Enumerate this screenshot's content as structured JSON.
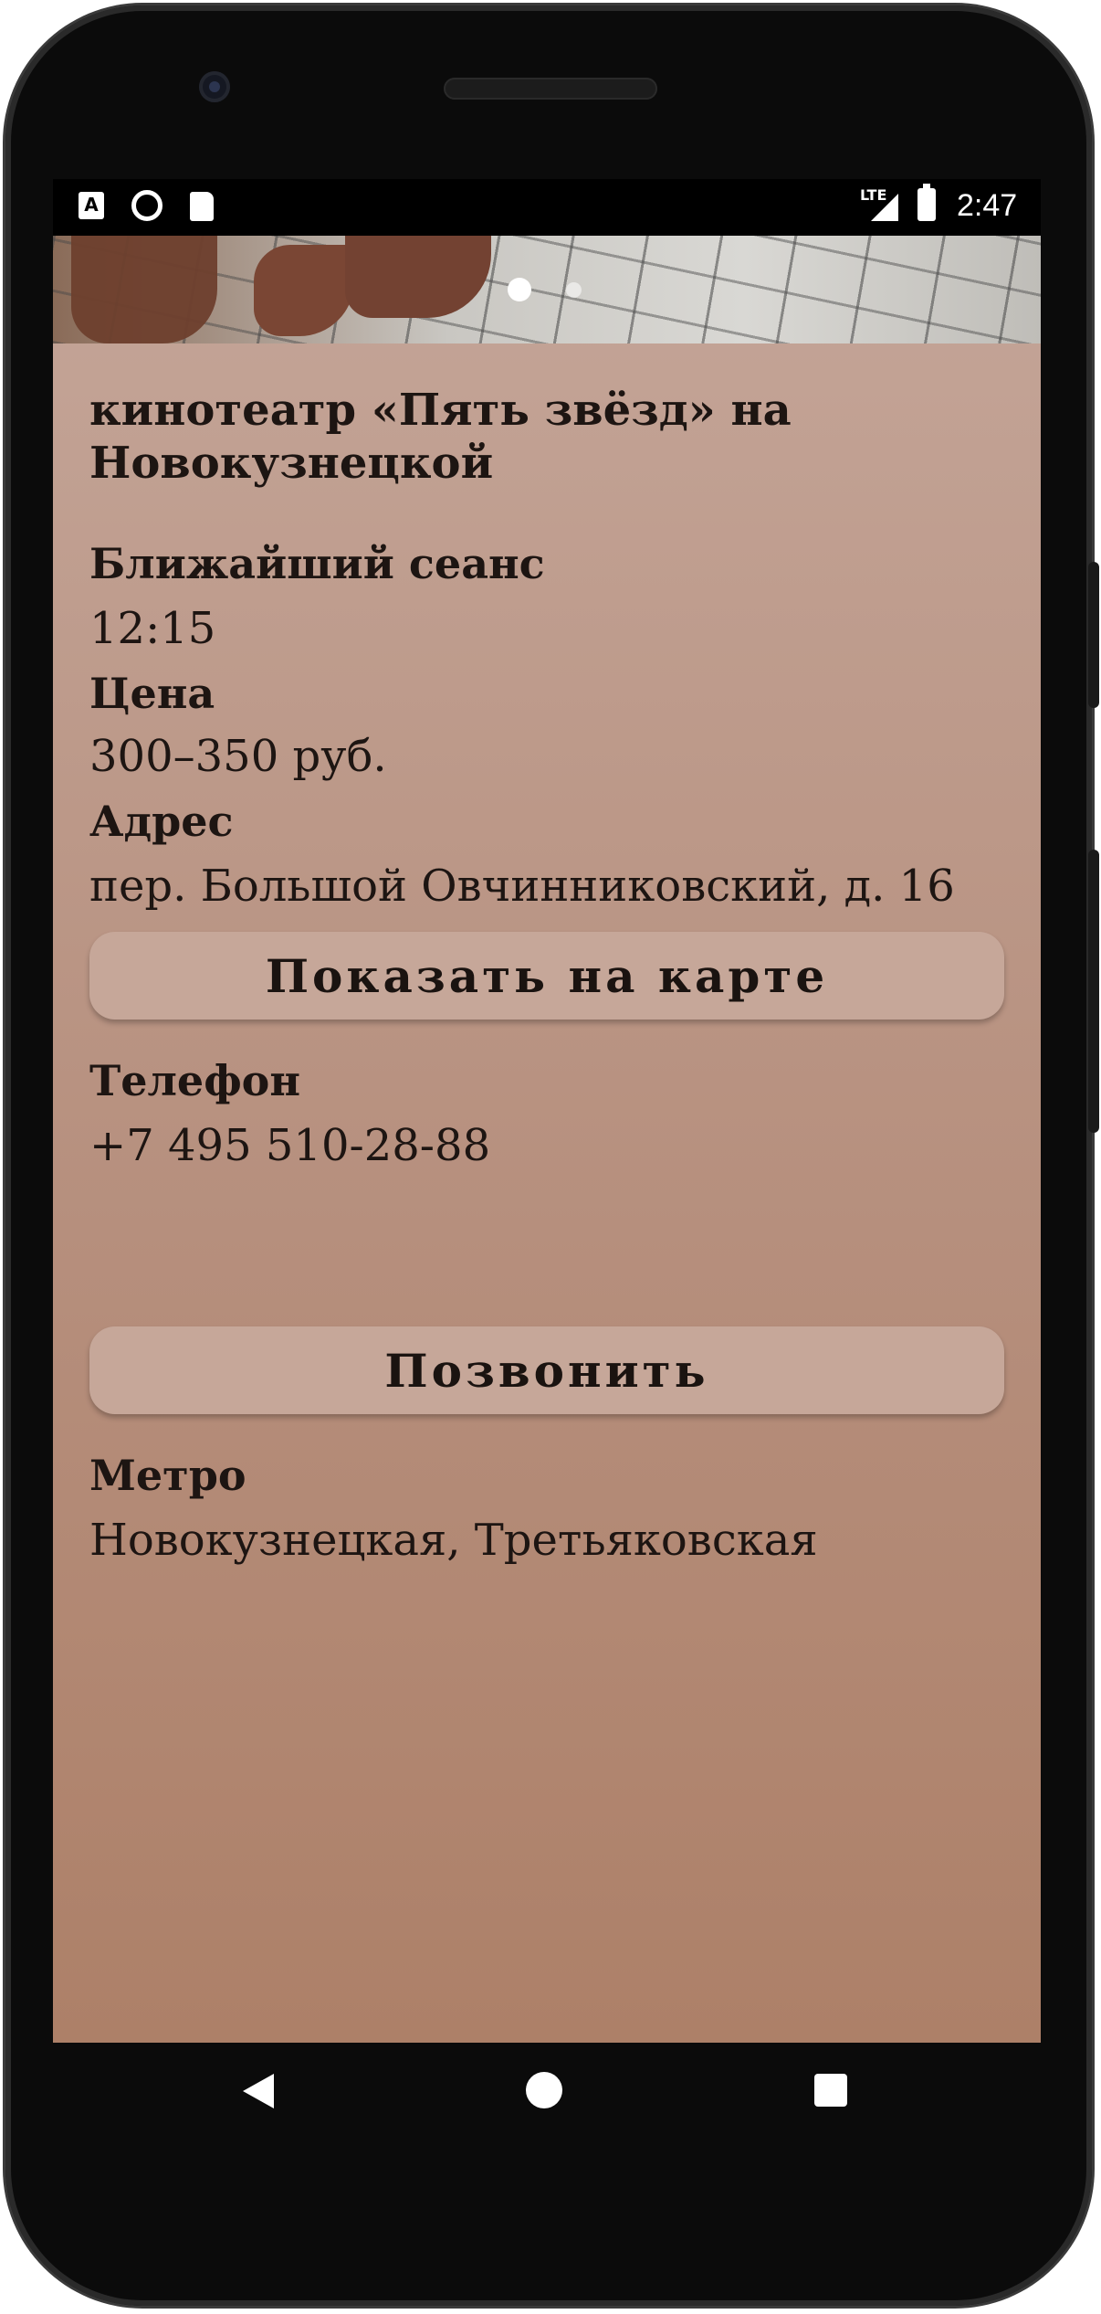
{
  "status_bar": {
    "time": "2:47",
    "network": "LTE",
    "icons": [
      "a-notification-icon",
      "record-icon",
      "sd-card-icon",
      "signal-icon",
      "battery-icon"
    ]
  },
  "carousel": {
    "image": "cafe-interior-photo",
    "pages": 2,
    "active_page": 1
  },
  "venue": {
    "title": "кинотеатр «Пять звёзд» на Новокузнецкой",
    "next_session_label": "Ближайший сеанс",
    "next_session_value": "12:15",
    "price_label": "Цена",
    "price_value": "300–350 руб.",
    "address_label": "Адрес",
    "address_value": "пер. Большой Овчинниковский, д. 16",
    "map_button": "Показать на карте",
    "phone_label": "Телефон",
    "phone_value": "+7 495 510-28-88",
    "call_button": "Позвонить",
    "metro_label": "Метро",
    "metro_value": "Новокузнецкая, Третьяковская"
  },
  "nav_bar": {
    "icons": [
      "back-icon",
      "home-icon",
      "recents-icon"
    ]
  },
  "colors": {
    "background_top": "#c4a598",
    "background_bottom": "#ad8068",
    "button": "#c6a799",
    "text": "#1d1512"
  }
}
